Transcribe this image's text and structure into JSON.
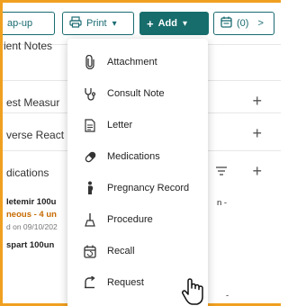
{
  "toolbar": {
    "popup_label": "ap-up",
    "print_label": "Print",
    "add_label": "Add",
    "cal_label": "(0)",
    "cal_chevron": ">"
  },
  "sections": [
    {
      "label": "ient Notes"
    },
    {
      "label": "est Measur"
    },
    {
      "label": "verse React"
    },
    {
      "label": "dications"
    }
  ],
  "medications": {
    "line1": "letemir 100u",
    "line2": "neous - 4 un",
    "line3": "d on 09/10/202",
    "line4": "spart 100un"
  },
  "side_text": {
    "right1": "n -",
    "right2": "-"
  },
  "menu": {
    "items": [
      {
        "label": "Attachment",
        "icon": "paperclip-icon"
      },
      {
        "label": "Consult Note",
        "icon": "consult-note-icon"
      },
      {
        "label": "Letter",
        "icon": "document-icon"
      },
      {
        "label": "Medications",
        "icon": "pill-icon"
      },
      {
        "label": "Pregnancy Record",
        "icon": "pregnancy-icon"
      },
      {
        "label": "Procedure",
        "icon": "procedure-icon"
      },
      {
        "label": "Recall",
        "icon": "calendar-icon"
      },
      {
        "label": "Request",
        "icon": "request-icon"
      }
    ]
  },
  "colors": {
    "accent": "#176d6c",
    "highlight_border": "#f0a020"
  }
}
